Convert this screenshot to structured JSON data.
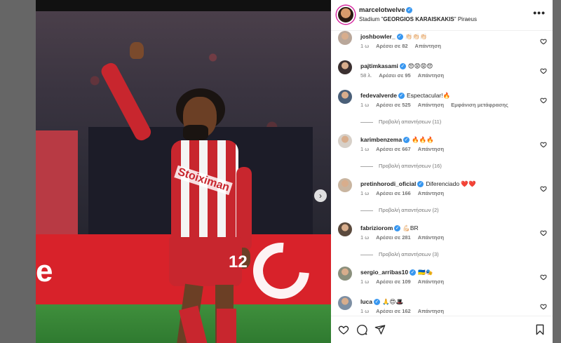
{
  "post": {
    "username": "marcelotwelve",
    "location_prefix": "Stadium \"",
    "location_name": "GEORGIOS KARAISKAKIS",
    "location_suffix": "\" Piraeus",
    "more_label": "•••",
    "next_label": "›"
  },
  "photo": {
    "shirt_number": "12",
    "sponsor": "Stoiximan",
    "adboard_letter": "e"
  },
  "comments": [
    {
      "user": "joshbowler_",
      "verified": true,
      "text": "👏🏻👏🏻👏🏻",
      "time": "1 ω",
      "likes": "Αρέσει σε 82",
      "reply": "Απάντηση",
      "translate": "",
      "replies": "",
      "avatar_color": "#b9a79a"
    },
    {
      "user": "pajtimkasami",
      "verified": true,
      "text": "😍😡😡😍",
      "time": "58 λ.",
      "likes": "Αρέσει σε 95",
      "reply": "Απάντηση",
      "translate": "",
      "replies": "",
      "avatar_color": "#3b3030"
    },
    {
      "user": "fedevalverde",
      "verified": true,
      "text": "Espectacular!🔥",
      "time": "1 ω",
      "likes": "Αρέσει σε 525",
      "reply": "Απάντηση",
      "translate": "Εμφάνιση μετάφρασης",
      "replies": "Προβολή απαντήσεων (11)",
      "avatar_color": "#4a5f78"
    },
    {
      "user": "karimbenzema",
      "verified": true,
      "text": "🔥🔥🔥",
      "time": "1 ω",
      "likes": "Αρέσει σε 667",
      "reply": "Απάντηση",
      "translate": "",
      "replies": "Προβολή απαντήσεων (16)",
      "avatar_color": "#d7d0c8"
    },
    {
      "user": "pretinhorodi_oficial",
      "verified": true,
      "text": "Diferenciado ❤️❤️",
      "time": "1 ω",
      "likes": "Αρέσει σε 166",
      "reply": "Απάντηση",
      "translate": "",
      "replies": "Προβολή απαντήσεων (2)",
      "avatar_color": "#c9b5a0"
    },
    {
      "user": "fabriziorom",
      "verified": true,
      "text": "💪🏻BR",
      "time": "1 ω",
      "likes": "Αρέσει σε 281",
      "reply": "Απάντηση",
      "translate": "",
      "replies": "Προβολή απαντήσεων (3)",
      "avatar_color": "#5b4a3d"
    },
    {
      "user": "sergio_arribas10",
      "verified": true,
      "text": "🇺🇦🎭",
      "time": "1 ω",
      "likes": "Αρέσει σε 109",
      "reply": "Απάντηση",
      "translate": "",
      "replies": "",
      "avatar_color": "#8a8f7c"
    },
    {
      "user": "luca",
      "verified": true,
      "text": "🙏😍🎩",
      "time": "1 ω",
      "likes": "Αρέσει σε 162",
      "reply": "Απάντηση",
      "translate": "",
      "replies": "",
      "avatar_color": "#7d8fa3"
    }
  ],
  "icons": {
    "like": "heart-icon",
    "comment": "comment-icon",
    "share": "share-icon",
    "save": "bookmark-icon"
  },
  "colors": {
    "verified": "#3897f0",
    "primary_text": "#262626",
    "secondary_text": "#737373",
    "story_ring": "#d6249f"
  }
}
